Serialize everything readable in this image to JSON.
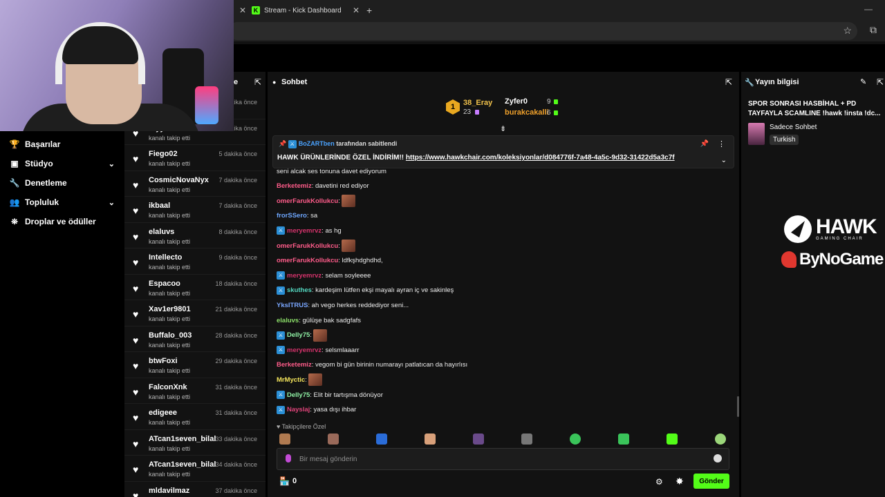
{
  "browser": {
    "active_tab_title": "Stream - Kick Dashboard",
    "favicon_letter": "K",
    "close_glyph": "✕",
    "new_tab_glyph": "+",
    "minimize_glyph": "—"
  },
  "nav": {
    "items": [
      {
        "label": "Başarılar",
        "icon": "trophy-icon",
        "glyph": "🏆"
      },
      {
        "label": "Stüdyo",
        "icon": "studio-icon",
        "glyph": "▣",
        "chevron": "⌄"
      },
      {
        "label": "Denetleme",
        "icon": "wrench-icon",
        "glyph": "🔧"
      },
      {
        "label": "Topluluk",
        "icon": "community-icon",
        "glyph": "👥",
        "chevron": "⌄"
      },
      {
        "label": "Droplar ve ödüller",
        "icon": "drops-icon",
        "glyph": "⛯"
      }
    ]
  },
  "followers": {
    "header": "e",
    "items": [
      {
        "name": "",
        "sub": "",
        "time": "dakika önce"
      },
      {
        "name": "reyy4...",
        "sub": "kanalı takip etti",
        "time": "dakika önce"
      },
      {
        "name": "Fiego02",
        "sub": "kanalı takip etti",
        "time": "5 dakika önce"
      },
      {
        "name": "CosmicNovaNyx",
        "sub": "kanalı takip etti",
        "time": "7 dakika önce"
      },
      {
        "name": "ikbaal",
        "sub": "kanalı takip etti",
        "time": "7 dakika önce"
      },
      {
        "name": "elaluvs",
        "sub": "kanalı takip etti",
        "time": "8 dakika önce"
      },
      {
        "name": "Intellecto",
        "sub": "kanalı takip etti",
        "time": "9 dakika önce"
      },
      {
        "name": "Espacoo",
        "sub": "kanalı takip etti",
        "time": "18 dakika önce"
      },
      {
        "name": "Xav1er9801",
        "sub": "kanalı takip etti",
        "time": "21 dakika önce"
      },
      {
        "name": "Buffalo_003",
        "sub": "kanalı takip etti",
        "time": "28 dakika önce"
      },
      {
        "name": "btwFoxi",
        "sub": "kanalı takip etti",
        "time": "29 dakika önce"
      },
      {
        "name": "FalconXnk",
        "sub": "kanalı takip etti",
        "time": "31 dakika önce"
      },
      {
        "name": "edigeee",
        "sub": "kanalı takip etti",
        "time": "31 dakika önce"
      },
      {
        "name": "ATcan1seven_bilal",
        "sub": "kanalı takip etti",
        "time": "33 dakika önce"
      },
      {
        "name": "ATcan1seven_bilal",
        "sub": "kanalı takip etti",
        "time": "34 dakika önce"
      },
      {
        "name": "mldavilmaz",
        "sub": "",
        "time": "37 dakika önce"
      }
    ]
  },
  "chat": {
    "title": "Sohbet",
    "leaderboard": {
      "rank": "1",
      "first": {
        "name": "38_Eray",
        "count": "23"
      },
      "second": {
        "name": "Zyfer0",
        "count": "9"
      },
      "third": {
        "name": "burakcakalli",
        "count": "6"
      }
    },
    "pinned": {
      "by_user": "BoZARTben",
      "by_suffix": "tarafından sabitlendi",
      "text": "HAWK ÜRÜNLERİNDE ÖZEL İNDİRİM!! ",
      "link": "https://www.hawkchair.com/koleksiyonlar/d084776f-7a48-4a5c-9d32-31422d5a3c7f"
    },
    "messages": [
      {
        "user": "",
        "color": "#e8506b",
        "text": "seni alcak ses tonuna davet ediyorum",
        "mod": false,
        "emote": false
      },
      {
        "user": "Berketemiz",
        "color": "#ff5c8a",
        "text": ": davetini red ediyor",
        "mod": false,
        "emote": false
      },
      {
        "user": "omerFarukKollukcu",
        "color": "#ff5c8a",
        "text": ": ",
        "mod": false,
        "emote": true
      },
      {
        "user": "frorSSero",
        "color": "#6fa8ff",
        "text": ": sa",
        "mod": false,
        "emote": false
      },
      {
        "user": "meryemrvz",
        "color": "#d6336c",
        "text": ": as hg",
        "mod": true,
        "emote": false
      },
      {
        "user": "omerFarukKollukcu",
        "color": "#ff5c8a",
        "text": ": ",
        "mod": false,
        "emote": true
      },
      {
        "user": "omerFarukKollukcu",
        "color": "#ff5c8a",
        "text": ": ldfkşhdghdhd,",
        "mod": false,
        "emote": false
      },
      {
        "user": "meryemrvz",
        "color": "#d6336c",
        "text": ": selam soyleeee",
        "mod": true,
        "emote": false
      },
      {
        "user": "skuthes",
        "color": "#54d8c1",
        "text": ": kardeşim lütfen ekşi mayalı ayran iç ve sakinleş",
        "mod": true,
        "emote": false
      },
      {
        "user": "YksITRUS",
        "color": "#7aa7ff",
        "text": ": ah vego herkes reddediyor seni...",
        "mod": false,
        "emote": false
      },
      {
        "user": "elaluvs",
        "color": "#8de06a",
        "text": ": gülüşe bak sadgfafs",
        "mod": false,
        "emote": false
      },
      {
        "user": "Delly75",
        "color": "#8ff0a4",
        "text": ": ",
        "mod": true,
        "emote": true
      },
      {
        "user": "meryemrvz",
        "color": "#d6336c",
        "text": ": selsmlaaarr",
        "mod": true,
        "emote": false
      },
      {
        "user": "Berketemiz",
        "color": "#ff5c8a",
        "text": ": vegom bi gün birinin numarayı patlatıcan da hayırlısı",
        "mod": false,
        "emote": false
      },
      {
        "user": "MrMyctic",
        "color": "#f5e65c",
        "text": ": ",
        "mod": false,
        "emote": true
      },
      {
        "user": "Delly75",
        "color": "#8ff0a4",
        "text": ": Elit bir tartışma dönüyor",
        "mod": true,
        "emote": false
      },
      {
        "user": "Nayslaj",
        "color": "#e0447a",
        "text": ": yasa dışı ihbar",
        "mod": true,
        "emote": false
      }
    ],
    "followers_only": "♥ Takipçilere Özel",
    "input_placeholder": "Bir mesaj gönderin",
    "store_count": "0",
    "send_label": "Gönder"
  },
  "info": {
    "title": "Yayın bilgisi",
    "stream_title": "SPOR SONRASI HASBİHAL + PD TAYFAYLA SCAMLINE !hawk !insta !dc...",
    "category": "Sadece Sohbet",
    "language": "Turkish",
    "sponsor1": "HAWK",
    "sponsor1_sub": "GAMING CHAIR",
    "sponsor2": "ByNoGame"
  },
  "colors": {
    "kick_green": "#53fc18",
    "panel_bg": "#121212",
    "mod_blue": "#2a8fd6"
  }
}
